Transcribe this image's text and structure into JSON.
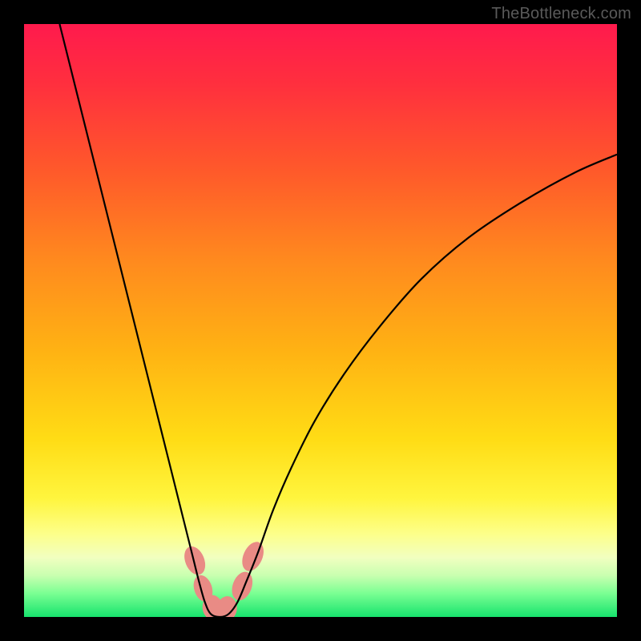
{
  "watermark": "TheBottleneck.com",
  "chart_data": {
    "type": "line",
    "title": "",
    "xlabel": "",
    "ylabel": "",
    "x_range": [
      0,
      100
    ],
    "y_range": [
      0,
      100
    ],
    "gradient_stops": [
      {
        "pos": 0.0,
        "color": "#ff1a4d"
      },
      {
        "pos": 0.1,
        "color": "#ff2f3e"
      },
      {
        "pos": 0.25,
        "color": "#ff5a2a"
      },
      {
        "pos": 0.4,
        "color": "#ff8a1e"
      },
      {
        "pos": 0.55,
        "color": "#ffb213"
      },
      {
        "pos": 0.7,
        "color": "#ffdc15"
      },
      {
        "pos": 0.8,
        "color": "#fff53e"
      },
      {
        "pos": 0.86,
        "color": "#fdff8a"
      },
      {
        "pos": 0.9,
        "color": "#f1ffc0"
      },
      {
        "pos": 0.93,
        "color": "#c9ffb0"
      },
      {
        "pos": 0.96,
        "color": "#7bff93"
      },
      {
        "pos": 1.0,
        "color": "#17e36d"
      }
    ],
    "series": [
      {
        "name": "bottleneck-curve",
        "color": "#000000",
        "width": 2.2,
        "points": [
          {
            "x": 6.0,
            "y": 100.0
          },
          {
            "x": 9.0,
            "y": 88.0
          },
          {
            "x": 12.0,
            "y": 76.0
          },
          {
            "x": 15.0,
            "y": 64.0
          },
          {
            "x": 18.0,
            "y": 52.0
          },
          {
            "x": 21.0,
            "y": 40.0
          },
          {
            "x": 23.0,
            "y": 32.0
          },
          {
            "x": 25.0,
            "y": 24.0
          },
          {
            "x": 27.0,
            "y": 16.0
          },
          {
            "x": 28.5,
            "y": 10.0
          },
          {
            "x": 29.5,
            "y": 6.0
          },
          {
            "x": 30.5,
            "y": 2.5
          },
          {
            "x": 31.5,
            "y": 0.5
          },
          {
            "x": 33.0,
            "y": 0.0
          },
          {
            "x": 34.5,
            "y": 0.5
          },
          {
            "x": 36.0,
            "y": 2.5
          },
          {
            "x": 37.5,
            "y": 6.0
          },
          {
            "x": 39.5,
            "y": 11.0
          },
          {
            "x": 42.0,
            "y": 18.0
          },
          {
            "x": 45.0,
            "y": 25.0
          },
          {
            "x": 49.0,
            "y": 33.0
          },
          {
            "x": 54.0,
            "y": 41.0
          },
          {
            "x": 60.0,
            "y": 49.0
          },
          {
            "x": 67.0,
            "y": 57.0
          },
          {
            "x": 75.0,
            "y": 64.0
          },
          {
            "x": 84.0,
            "y": 70.0
          },
          {
            "x": 93.0,
            "y": 75.0
          },
          {
            "x": 100.0,
            "y": 78.0
          }
        ]
      }
    ],
    "marker_blobs": [
      {
        "cx": 28.8,
        "cy": 9.5,
        "w": 3.2,
        "h": 5.0,
        "rot": -22
      },
      {
        "cx": 30.2,
        "cy": 4.8,
        "w": 3.0,
        "h": 4.6,
        "rot": -18
      },
      {
        "cx": 31.8,
        "cy": 1.6,
        "w": 3.4,
        "h": 4.2,
        "rot": -5
      },
      {
        "cx": 34.2,
        "cy": 1.4,
        "w": 3.4,
        "h": 4.2,
        "rot": 8
      },
      {
        "cx": 36.8,
        "cy": 5.2,
        "w": 3.2,
        "h": 5.0,
        "rot": 20
      },
      {
        "cx": 38.6,
        "cy": 10.2,
        "w": 3.2,
        "h": 5.2,
        "rot": 24
      }
    ],
    "marker_color": "#e98b85"
  }
}
